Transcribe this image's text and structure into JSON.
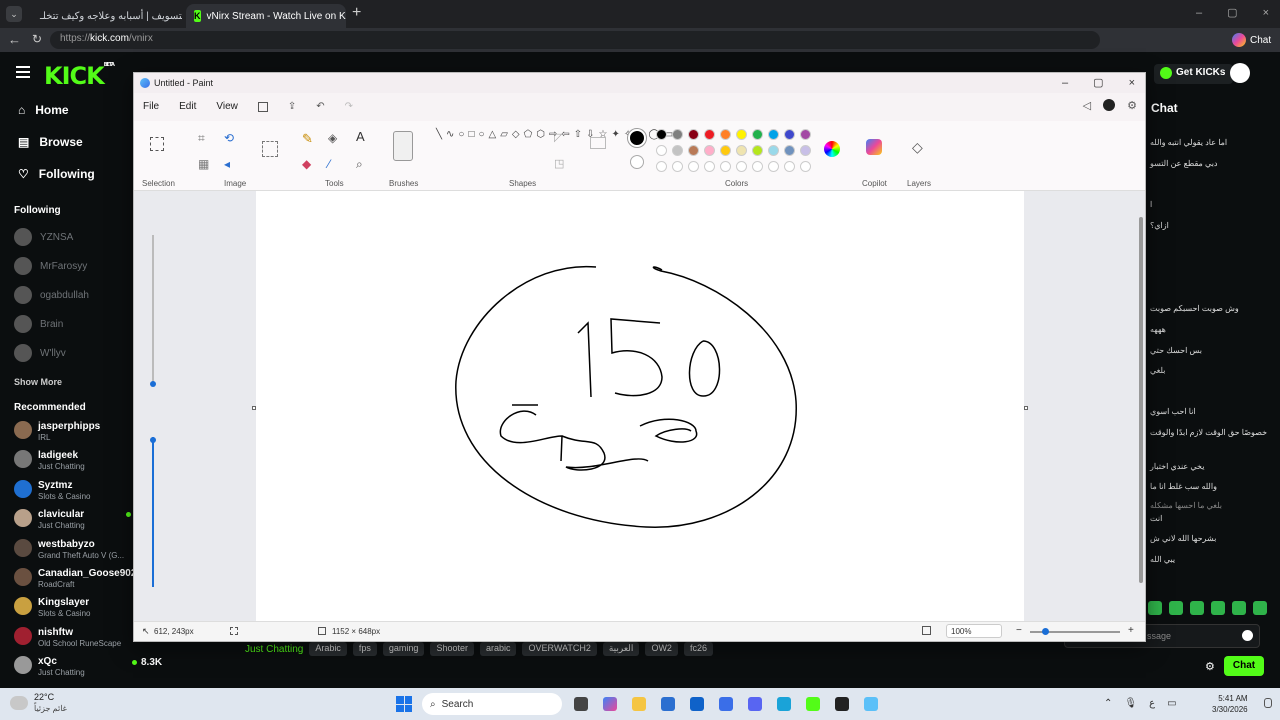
{
  "browser": {
    "tabs": [
      {
        "label": "التسويف | أسبابه وعلاجه وكيف تتخلـ",
        "active": false
      },
      {
        "label": "vNirx Stream - Watch Live on Kick",
        "active": true
      }
    ],
    "url_prefix": "https://",
    "url_domain": "kick.com",
    "url_path": "/vnirx",
    "chat_button": "Chat"
  },
  "kick": {
    "logo": "KICK",
    "logo_beta": "BETA",
    "nav": [
      {
        "label": "Home",
        "icon": "home-icon"
      },
      {
        "label": "Browse",
        "icon": "browse-icon"
      },
      {
        "label": "Following",
        "icon": "heart-icon"
      }
    ],
    "following_title": "Following",
    "following": [
      "YZNSA",
      "MrFarosyy",
      "ogabdullah",
      "Brain",
      "W'llyv"
    ],
    "show_more": "Show More",
    "recommended_title": "Recommended",
    "recommended": [
      {
        "name": "jasperphipps",
        "sub": "IRL"
      },
      {
        "name": "ladigeek",
        "sub": "Just Chatting"
      },
      {
        "name": "Syztmz",
        "sub": "Slots & Casino"
      },
      {
        "name": "clavicular",
        "sub": "Just Chatting"
      },
      {
        "name": "westbabyzo",
        "sub": "Grand Theft Auto V (G..."
      },
      {
        "name": "Canadian_Goose902",
        "sub": "RoadCraft"
      },
      {
        "name": "Kingslayer",
        "sub": "Slots & Casino"
      },
      {
        "name": "nishftw",
        "sub": "Old School RuneScape"
      },
      {
        "name": "xQc",
        "sub": "Just Chatting",
        "viewers": "8.3K"
      }
    ],
    "get_kicks": "Get KICKs",
    "chat_title": "Chat",
    "chat_lines": [
      "اما عاد يقولي انتبه والله",
      "دبي مقطع عن التسو",
      "ا",
      "ازاي؟",
      "وش صوبت احسبكم صوبت",
      "هههه",
      "بس احسك حتي",
      "بلغي",
      "انا احب اسوي",
      "خصوصًا حق الوقت لازم ابدًا والوقت",
      "يخي عندي اختبار",
      "والله سب غلط انا ما",
      "بلغي ما احسها مشكله",
      "انت",
      "بشرحها الله لاني ش",
      "يبي الله"
    ],
    "chat_placeholder": "ssage",
    "chat_send": "Chat",
    "stream_tags": [
      "Just Chatting",
      "Arabic",
      "fps",
      "gaming",
      "Shooter",
      "arabic",
      "OVERWATCH2",
      "العربية",
      "OW2",
      "fc26"
    ]
  },
  "paint": {
    "title": "Untitled - Paint",
    "menu": [
      "File",
      "Edit",
      "View"
    ],
    "groups": [
      "Selection",
      "Image",
      "Tools",
      "Brushes",
      "Shapes",
      "Colors",
      "Copilot",
      "Layers"
    ],
    "colors": [
      "#000000",
      "#7f7f7f",
      "#880015",
      "#ed1c24",
      "#ff7f27",
      "#fff200",
      "#22b14c",
      "#00a2e8",
      "#3f48cc",
      "#a349a4",
      "#ffffff",
      "#c3c3c3",
      "#b97a57",
      "#ffaec9",
      "#ffc90e",
      "#efe4b0",
      "#b5e61d",
      "#99d9ea",
      "#7092be",
      "#c8bfe7"
    ],
    "status_cursor": "612, 243px",
    "status_size": "1152 × 648px",
    "zoom": "100%"
  },
  "taskbar": {
    "weather_temp": "22°C",
    "weather_desc": "غائم جزئياً",
    "search": "Search",
    "lang": "ع",
    "time": "5:41 AM",
    "date": "3/30/2026"
  }
}
